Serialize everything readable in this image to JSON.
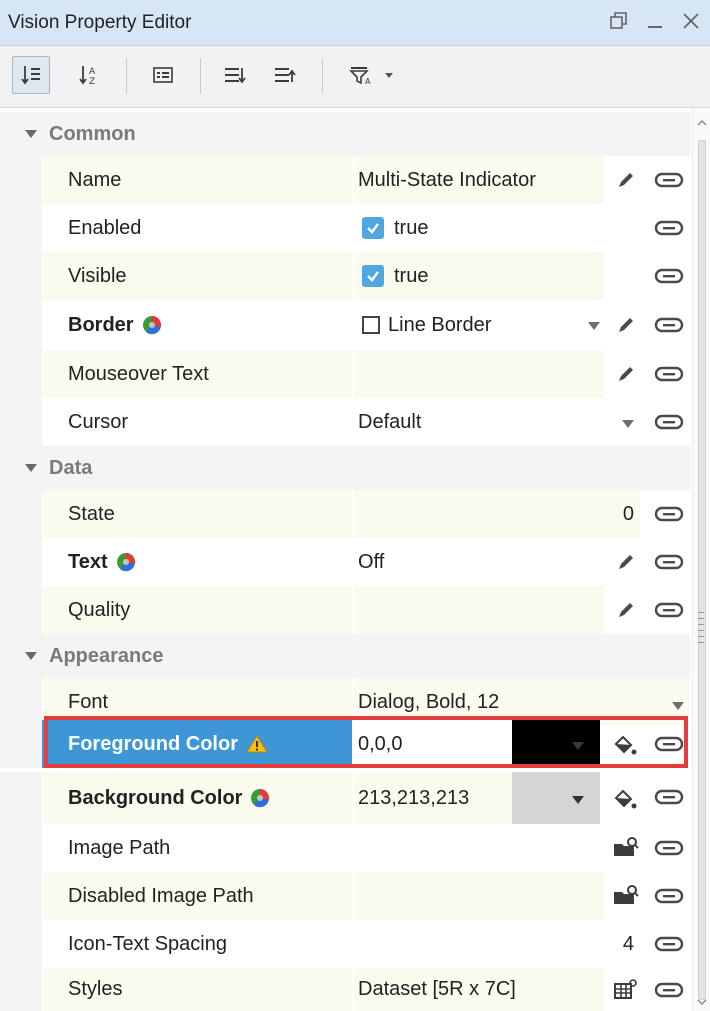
{
  "window": {
    "title": "Vision Property Editor"
  },
  "categories": [
    {
      "label": "Common"
    },
    {
      "label": "Data"
    },
    {
      "label": "Appearance"
    }
  ],
  "rows": {
    "name": {
      "label": "Name",
      "value": "Multi-State Indicator"
    },
    "enabled": {
      "label": "Enabled",
      "value": "true"
    },
    "visible": {
      "label": "Visible",
      "value": "true"
    },
    "border": {
      "label": "Border",
      "value": "Line Border"
    },
    "mouseover": {
      "label": "Mouseover Text",
      "value": ""
    },
    "cursor": {
      "label": "Cursor",
      "value": "Default"
    },
    "state": {
      "label": "State",
      "value": "0"
    },
    "text": {
      "label": "Text",
      "value": "Off"
    },
    "quality": {
      "label": "Quality",
      "value": ""
    },
    "font": {
      "label": "Font",
      "value": "Dialog, Bold, 12"
    },
    "fgcolor": {
      "label": "Foreground Color",
      "value": "0,0,0",
      "swatch": "#000000"
    },
    "bgcolor": {
      "label": "Background Color",
      "value": "213,213,213",
      "swatch": "#d5d5d5"
    },
    "imagepath": {
      "label": "Image Path",
      "value": ""
    },
    "disabledimagepath": {
      "label": "Disabled Image Path",
      "value": ""
    },
    "iconspacing": {
      "label": "Icon-Text Spacing",
      "value": "4"
    },
    "styles": {
      "label": "Styles",
      "value": "Dataset [5R x 7C]"
    }
  },
  "colors": {
    "selection": "#3d97d6",
    "highlight": "#e53c3c",
    "checkbox": "#4fa6e0",
    "warning": "#f2c01e"
  }
}
